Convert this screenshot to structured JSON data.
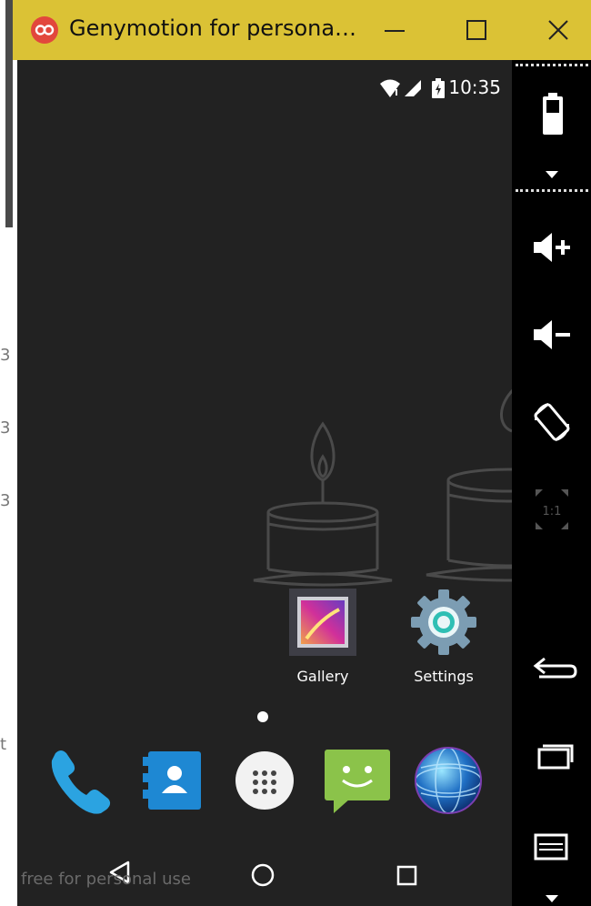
{
  "window": {
    "title": "Genymotion for persona…",
    "logo_text": "oo",
    "accent_color": "#dbc235",
    "buttons": [
      "minimize-icon",
      "maximize-icon",
      "close-icon"
    ]
  },
  "status_bar": {
    "time": "10:35",
    "icons": [
      "wifi-icon",
      "signal-icon",
      "battery-icon"
    ]
  },
  "home": {
    "apps": [
      {
        "label": "Gallery",
        "icon": "gallery-icon"
      },
      {
        "label": "Settings",
        "icon": "settings-icon"
      }
    ],
    "dock": [
      "phone-icon",
      "contacts-icon",
      "app-drawer-icon",
      "messaging-icon",
      "browser-icon"
    ]
  },
  "nav_bar": {
    "buttons": [
      "back-icon",
      "home-icon",
      "recents-icon"
    ],
    "watermark": "free for personal use"
  },
  "toolbar": {
    "buttons": [
      "battery-widget-icon",
      "volume-up-icon",
      "volume-down-icon",
      "rotate-icon",
      "pixel-perfect-icon",
      "android-back-icon",
      "android-recents-icon",
      "android-menu-icon"
    ],
    "pixel_perfect_label": "1:1"
  }
}
